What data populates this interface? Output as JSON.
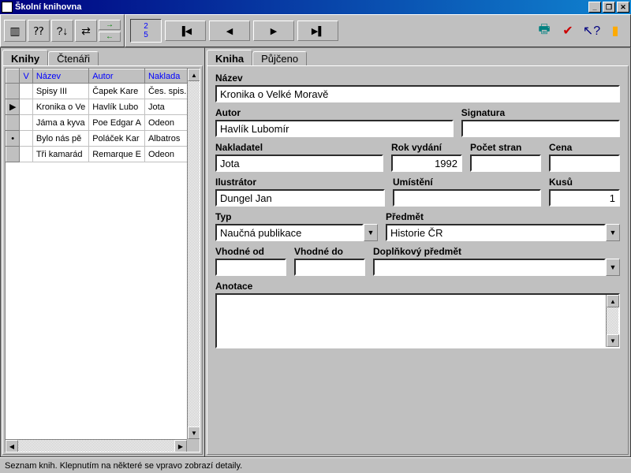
{
  "window": {
    "title": "Školní knihovna"
  },
  "toolbar": {
    "counter_top": "2",
    "counter_bottom": "5"
  },
  "left": {
    "tabs": {
      "books": "Knihy",
      "readers": "Čtenáři"
    },
    "columns": {
      "v": "V",
      "nazev": "Název",
      "autor": "Autor",
      "naklad": "Naklada"
    },
    "rows": [
      {
        "marker": "",
        "nazev": "Spisy III",
        "autor": "Čapek Kare",
        "naklad": "Čes. spis."
      },
      {
        "marker": "▶",
        "nazev": "Kronika o Ve",
        "autor": "Havlík Lubo",
        "naklad": "Jota"
      },
      {
        "marker": "",
        "nazev": "Jáma a kyva",
        "autor": "Poe Edgar A",
        "naklad": "Odeon"
      },
      {
        "marker": "•",
        "nazev": "Bylo nás pě",
        "autor": "Poláček Kar",
        "naklad": "Albatros"
      },
      {
        "marker": "",
        "nazev": "Tři kamarád",
        "autor": "Remarque E",
        "naklad": "Odeon"
      }
    ]
  },
  "right": {
    "tabs": {
      "book": "Kniha",
      "loaned": "Půjčeno"
    },
    "labels": {
      "nazev": "Název",
      "autor": "Autor",
      "signatura": "Signatura",
      "nakladatel": "Nakladatel",
      "rok": "Rok vydání",
      "stran": "Počet stran",
      "cena": "Cena",
      "ilustrator": "Ilustrátor",
      "umisteni": "Umístění",
      "kusu": "Kusů",
      "typ": "Typ",
      "predmet": "Předmět",
      "vhod_od": "Vhodné od",
      "vhod_do": "Vhodné do",
      "dopl": "Doplňkový předmět",
      "anotace": "Anotace"
    },
    "values": {
      "nazev": "Kronika o Velké Moravě",
      "autor": "Havlík Lubomír",
      "signatura": "",
      "nakladatel": "Jota",
      "rok": "1992",
      "stran": "",
      "cena": "",
      "ilustrator": "Dungel Jan",
      "umisteni": "",
      "kusu": "1",
      "typ": "Naučná publikace",
      "predmet": "Historie ČR",
      "vhod_od": "",
      "vhod_do": "",
      "dopl": "",
      "anotace": ""
    }
  },
  "status": "Seznam knih. Klepnutím na některé se vpravo zobrazí detaily."
}
